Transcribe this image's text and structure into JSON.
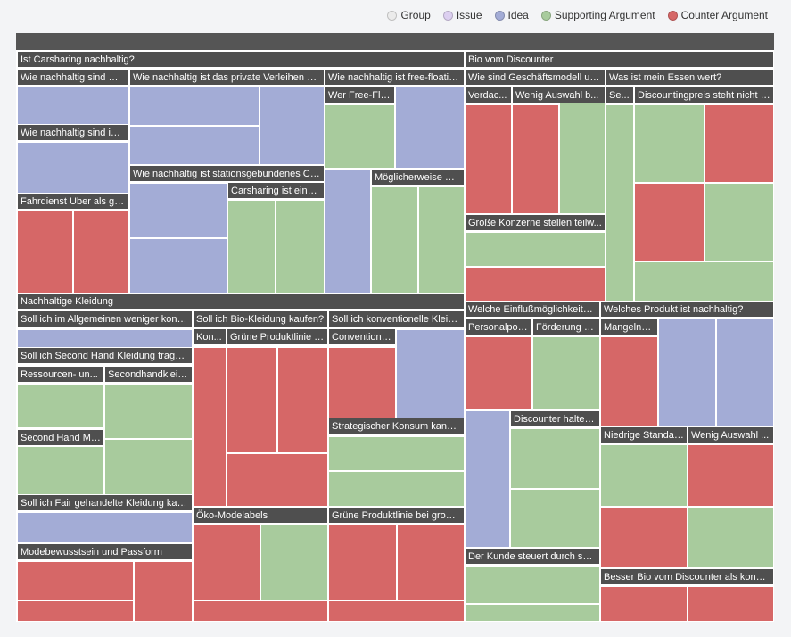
{
  "colors": {
    "group": "#ebebeb",
    "issue": "#dccff0",
    "idea": "#a3acd6",
    "supporting": "#a8cb9d",
    "counter": "#d66767",
    "header": "#4f4f4f"
  },
  "legend": [
    {
      "label": "Group",
      "kind": "group"
    },
    {
      "label": "Issue",
      "kind": "issue"
    },
    {
      "label": "Idea",
      "kind": "idea"
    },
    {
      "label": "Supporting Argument",
      "kind": "supporting"
    },
    {
      "label": "Counter Argument",
      "kind": "counter"
    }
  ],
  "chart_data": {
    "type": "treemap",
    "categories": [
      "Group",
      "Issue",
      "Idea",
      "Supporting Argument",
      "Counter Argument"
    ],
    "headers": [
      "Ist Carsharing nachhaltig?",
      "Bio vom Discounter",
      "Wie nachhaltig sind Mit...",
      "Wie nachhaltig ist das private Verleihen vo...",
      "Wie nachhaltig ist free-floatin...",
      "Wie sind Geschäftsmodell un...",
      "Was ist mein Essen wert?",
      "Verdac...",
      "Wenig Auswahl b...",
      "Se...",
      "Discountingpreis steht nicht f...",
      "Wer Free-Flo...",
      "Wie nachhaltig sind inn...",
      "Wie nachhaltig ist stationsgebundenes Car...",
      "Möglicherweise m...",
      "Carsharing ist eine ...",
      "Fahrdienst Uber als gü...",
      "Große Konzerne stellen teilw...",
      "Nachhaltige Kleidung",
      "Welche Einflußmöglichkeiten...",
      "Welches Produkt ist nachhaltig?",
      "Soll ich im Allgemeinen weniger kons...",
      "Soll ich Bio-Kleidung kaufen?",
      "Soll ich konventionelle Kleidu...",
      "Personalpolitik",
      "Förderung d...",
      "Mangelnd...",
      "Kon...",
      "Grüne Produktlinie b...",
      "Conventione...",
      "Soll ich Second Hand Kleidung tragen?",
      "Ressourcen- un...",
      "Secondhandkleid...",
      "Discounter halten...",
      "Strategischer Konsum kann ...",
      "Niedrige Standar...",
      "Wenig Auswahl ...",
      "Second Hand Mo...",
      "Soll ich Fair gehandelte Kleidung kauf...",
      "Öko-Modelabels",
      "Grüne Produktlinie bei große...",
      "Modebewusstsein und Passform",
      "Der Kunde steuert durch sei...",
      "Besser Bio vom Discounter als konve..."
    ]
  }
}
